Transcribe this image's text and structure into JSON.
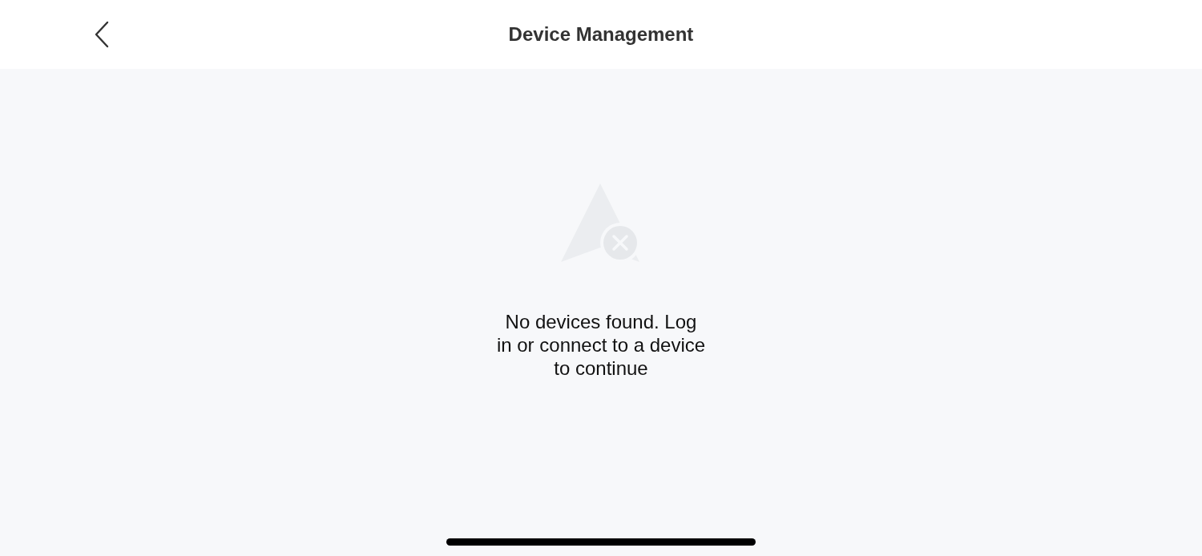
{
  "header": {
    "title": "Device Management"
  },
  "empty_state": {
    "message": "No devices found. Log in or connect to a device to continue"
  }
}
